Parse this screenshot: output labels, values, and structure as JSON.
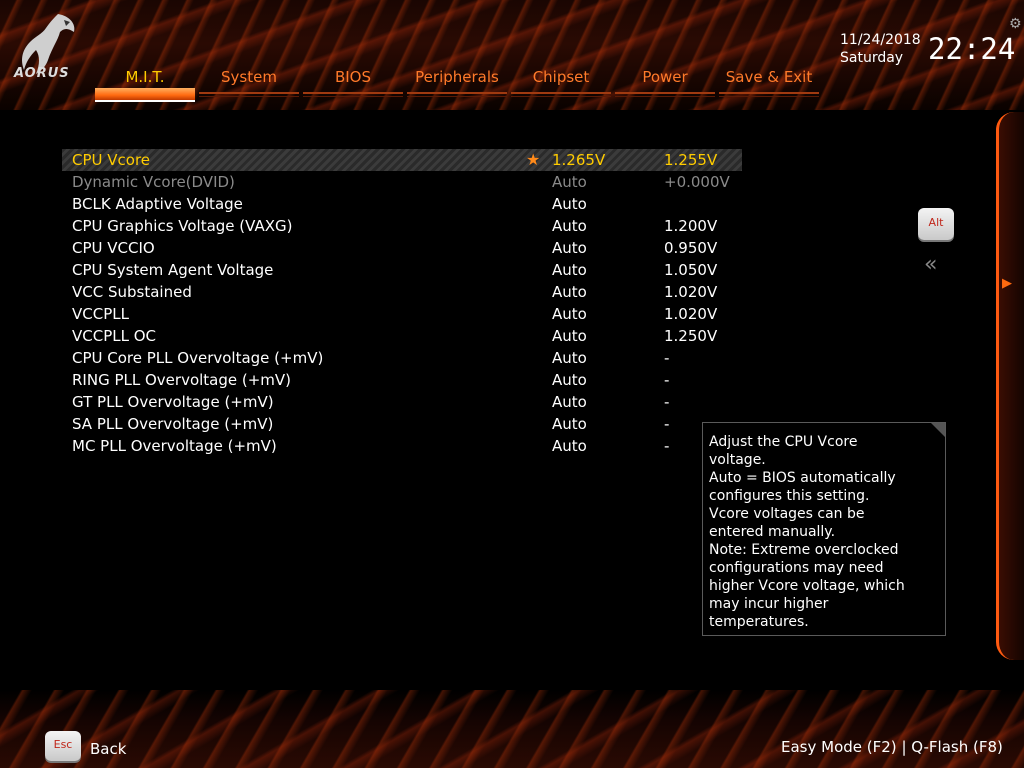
{
  "brand": {
    "logo_text": "AORUS"
  },
  "tabs": [
    {
      "label": "M.I.T.",
      "active": true
    },
    {
      "label": "System"
    },
    {
      "label": "BIOS"
    },
    {
      "label": "Peripherals"
    },
    {
      "label": "Chipset"
    },
    {
      "label": "Power"
    },
    {
      "label": "Save & Exit"
    }
  ],
  "clock": {
    "date": "11/24/2018",
    "day": "Saturday",
    "time": "22:24"
  },
  "settings": [
    {
      "name": "CPU Vcore",
      "value": "1.265V",
      "current": "1.255V",
      "selected": true,
      "starred": true
    },
    {
      "name": "Dynamic Vcore(DVID)",
      "value": "Auto",
      "current": "+0.000V",
      "disabled": true
    },
    {
      "name": "BCLK Adaptive Voltage",
      "value": "Auto",
      "current": ""
    },
    {
      "name": "CPU Graphics Voltage (VAXG)",
      "value": "Auto",
      "current": "1.200V"
    },
    {
      "name": "CPU VCCIO",
      "value": "Auto",
      "current": "0.950V"
    },
    {
      "name": "CPU System Agent Voltage",
      "value": "Auto",
      "current": "1.050V"
    },
    {
      "name": "VCC Substained",
      "value": "Auto",
      "current": "1.020V"
    },
    {
      "name": "VCCPLL",
      "value": "Auto",
      "current": "1.020V"
    },
    {
      "name": "VCCPLL OC",
      "value": "Auto",
      "current": "1.250V"
    },
    {
      "name": "CPU Core PLL Overvoltage (+mV)",
      "value": "Auto",
      "current": "-"
    },
    {
      "name": "RING PLL Overvoltage (+mV)",
      "value": "Auto",
      "current": "-"
    },
    {
      "name": "GT PLL Overvoltage (+mV)",
      "value": "Auto",
      "current": "-"
    },
    {
      "name": "SA PLL Overvoltage (+mV)",
      "value": "Auto",
      "current": "-"
    },
    {
      "name": "MC PLL Overvoltage (+mV)",
      "value": "Auto",
      "current": "-"
    }
  ],
  "help": {
    "lines": [
      "Adjust the CPU Vcore",
      "voltage.",
      "Auto = BIOS automatically",
      "configures this setting.",
      "Vcore voltages can be",
      "entered manually.",
      "Note: Extreme overclocked",
      "configurations may need",
      "higher Vcore voltage, which",
      "may incur higher",
      "temperatures."
    ]
  },
  "buttons": {
    "alt": "Alt",
    "esc": "Esc",
    "back": "Back",
    "collapse": "«"
  },
  "footer": {
    "easy_mode": "Easy Mode (F2)",
    "separator": "|",
    "qflash": "Q-Flash (F8)"
  },
  "icons": {
    "favorite": "star-icon",
    "settings": "gear-icon",
    "side_panel": "chevron-right-icon"
  },
  "colors": {
    "accent": "#ff7a2a",
    "selected_text": "#ffcc00",
    "star": "#ff8a1a"
  }
}
